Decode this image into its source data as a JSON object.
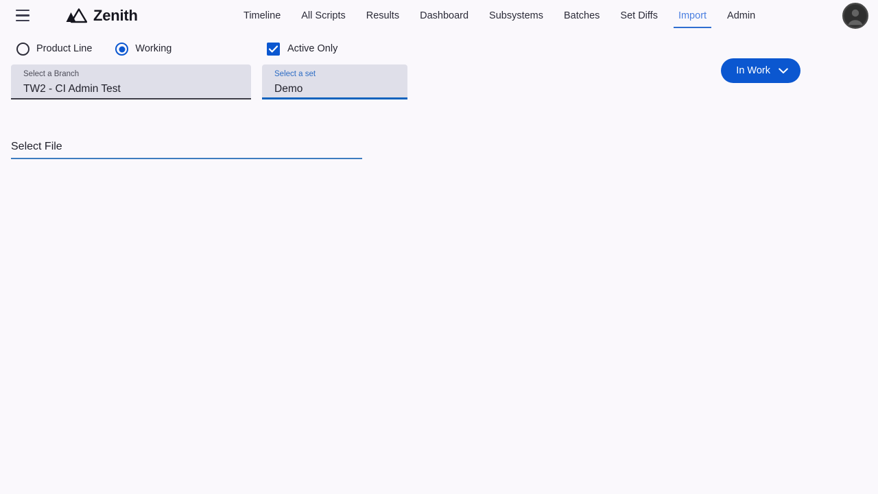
{
  "app": {
    "brand": "Zenith",
    "menu_icon": "hamburger-menu-icon",
    "logo_icon": "mountain-logo-icon",
    "avatar_icon": "user-avatar-icon",
    "background_color": "#faf8fc",
    "accent_color": "#0b57d0"
  },
  "nav": {
    "items": [
      {
        "label": "Timeline",
        "active": false
      },
      {
        "label": "All Scripts",
        "active": false
      },
      {
        "label": "Results",
        "active": false
      },
      {
        "label": "Dashboard",
        "active": false
      },
      {
        "label": "Subsystems",
        "active": false
      },
      {
        "label": "Batches",
        "active": false
      },
      {
        "label": "Set Diffs",
        "active": false
      },
      {
        "label": "Import",
        "active": true
      },
      {
        "label": "Admin",
        "active": false
      }
    ],
    "active_color": "#4a7fe0",
    "underline_color": "#2f6fd0"
  },
  "filters": {
    "radios": [
      {
        "label": "Product Line",
        "selected": false
      },
      {
        "label": "Working",
        "selected": true
      }
    ],
    "checkbox": {
      "label": "Active Only",
      "checked": true,
      "icon": "checkmark-icon"
    }
  },
  "fields": {
    "branch": {
      "label": "Select a Branch",
      "value": "TW2 - CI Admin Test",
      "focused": false
    },
    "set": {
      "label": "Select a set",
      "value": "Demo",
      "focused": true
    }
  },
  "actions": {
    "in_work": {
      "label": "In Work",
      "icon": "chevron-down-icon",
      "color": "#0b57d0"
    }
  },
  "file_picker": {
    "label": "Select File",
    "underline_color": "#3d7cc0"
  }
}
